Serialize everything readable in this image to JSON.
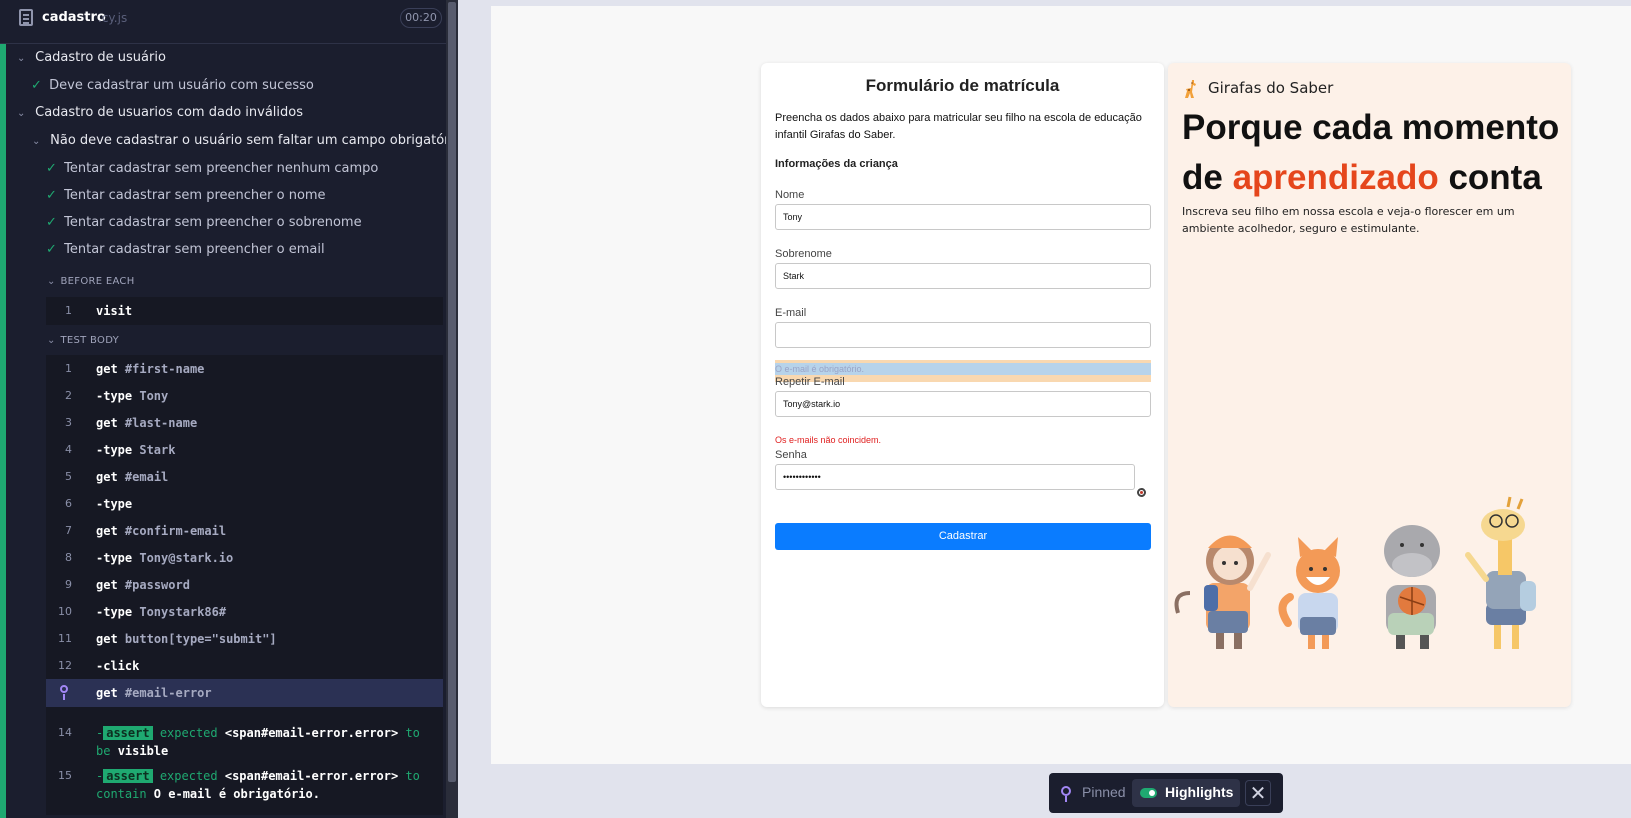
{
  "runner": {
    "spec_name": "cadastro",
    "spec_ext": ".cy.js",
    "duration": "00:20",
    "suites": [
      {
        "title": "Cadastro de usuário"
      },
      {
        "title": "Cadastro de usuarios com dado inválidos"
      },
      {
        "title": "Não deve cadastrar o usuário sem faltar um campo obrigatório"
      }
    ],
    "tests": [
      "Deve cadastrar um usuário com sucesso",
      "Tentar cadastrar sem preencher nenhum campo",
      "Tentar cadastrar sem preencher o nome",
      "Tentar cadastrar sem preencher o sobrenome",
      "Tentar cadastrar sem preencher o email"
    ],
    "before_each_label": "BEFORE EACH",
    "before_each": [
      {
        "num": "1",
        "name": "visit",
        "arg": ""
      }
    ],
    "test_body_label": "TEST BODY",
    "commands": [
      {
        "num": "1",
        "name": "get",
        "arg": "#first-name"
      },
      {
        "num": "2",
        "name": "-type",
        "arg": "Tony"
      },
      {
        "num": "3",
        "name": "get",
        "arg": "#last-name"
      },
      {
        "num": "4",
        "name": "-type",
        "arg": "Stark"
      },
      {
        "num": "5",
        "name": "get",
        "arg": "#email"
      },
      {
        "num": "6",
        "name": "-type",
        "arg": ""
      },
      {
        "num": "7",
        "name": "get",
        "arg": "#confirm-email"
      },
      {
        "num": "8",
        "name": "-type",
        "arg": "Tony@stark.io"
      },
      {
        "num": "9",
        "name": "get",
        "arg": "#password"
      },
      {
        "num": "10",
        "name": "-type",
        "arg": "Tonystark86#"
      },
      {
        "num": "11",
        "name": "get",
        "arg": "button[type=\"submit\"]"
      },
      {
        "num": "12",
        "name": "-click",
        "arg": ""
      },
      {
        "num": "",
        "name": "get",
        "arg": "#email-error"
      }
    ],
    "asserts": [
      {
        "num": "14",
        "dash": "-",
        "badge": "assert",
        "text1": " expected ",
        "subject": "<span#email-error.error>",
        "text2": " to be ",
        "value": "visible"
      },
      {
        "num": "15",
        "dash": "-",
        "badge": "assert",
        "text1": " expected ",
        "subject": "<span#email-error.error>",
        "text2": " to contain ",
        "value": "O e-mail é obrigatório."
      }
    ]
  },
  "form": {
    "title": "Formulário de matrícula",
    "intro": "Preencha os dados abaixo para matricular seu filho na escola de educação infantil Girafas do Saber.",
    "section": "Informações da criança",
    "fields": {
      "first_name": {
        "label": "Nome",
        "value": "Tony"
      },
      "last_name": {
        "label": "Sobrenome",
        "value": "Stark"
      },
      "email": {
        "label": "E-mail",
        "value": ""
      },
      "confirm_email": {
        "label": "Repetir E-mail",
        "value": "Tony@stark.io"
      },
      "password": {
        "label": "Senha",
        "value": "••••••••••••"
      }
    },
    "email_error": "O e-mail é obrigatório.",
    "confirm_error": "Os e-mails não coincidem.",
    "submit_label": "Cadastrar"
  },
  "hero": {
    "brand": "Girafas do Saber",
    "headline_part1": "Porque cada momento de ",
    "headline_accent": "aprendizado",
    "headline_part2": " conta",
    "subtitle": "Inscreva seu filho em nossa escola e veja-o florescer em um ambiente acolhedor, seguro e estimulante.",
    "accent_color": "#e5461c"
  },
  "pin_bar": {
    "pinned_label": "Pinned",
    "highlights_label": "Highlights",
    "highlights_on": true,
    "close_glyph": "✕"
  },
  "icons": [
    "file-icon",
    "chevron-down-icon",
    "check-icon",
    "pin-icon",
    "eye-icon",
    "giraffe-logo-icon",
    "toggle-icon",
    "close-icon"
  ]
}
